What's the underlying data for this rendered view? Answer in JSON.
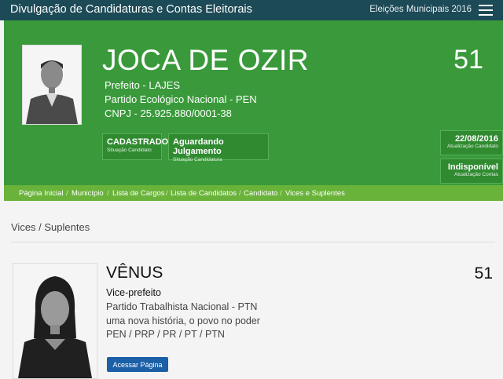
{
  "topbar": {
    "title": "Divulgação de Candidaturas e Contas Eleitorais",
    "election": "Eleições Municipais 2016"
  },
  "candidate": {
    "name": "JOCA DE OZIR",
    "number": "51",
    "office": "Prefeito - LAJES",
    "party": "Partido Ecológico Nacional - PEN",
    "cnpj": "CNPJ - 25.925.880/0001-38",
    "status_badges": [
      {
        "value": "CADASTRADO",
        "label": "Situação Candidato"
      },
      {
        "value": "Aguardando Julgamento",
        "label": "Situação Candidatura"
      }
    ],
    "side_badges": [
      {
        "value": "22/08/2016",
        "label": "Atualização Candidato"
      },
      {
        "value": "Indisponível",
        "label": "Atualização Contas"
      }
    ]
  },
  "breadcrumb": [
    "Página Inicial",
    "Município",
    "Lista de Cargos",
    "Lista de Candidatos",
    "Candidato",
    "Vices e Suplentes"
  ],
  "section": {
    "title": "Vices / Suplentes"
  },
  "vice": {
    "name": "VÊNUS",
    "number": "51",
    "role": "Vice-prefeito",
    "party": "Partido Trabalhista Nacional - PTN",
    "coalition": "uma nova história, o povo no poder",
    "parties": "PEN / PRP / PR / PT / PTN",
    "button": "Acessar Página"
  }
}
